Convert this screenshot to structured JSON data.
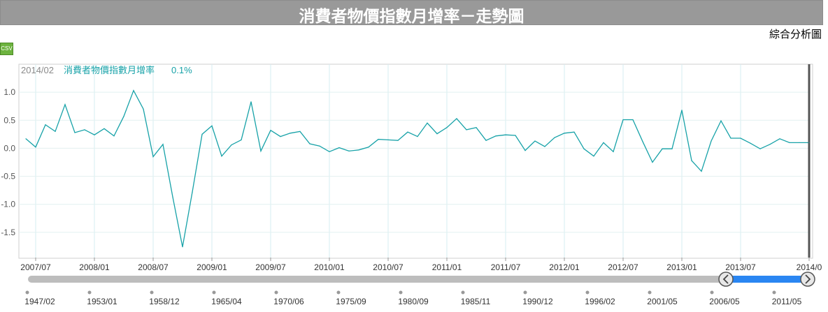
{
  "page": {
    "title": "消費者物價指數月增率－走勢圖",
    "composite_link": "綜合分析圖",
    "csv_button": "CSV"
  },
  "colors": {
    "line": "#17a2a8",
    "title_bar": "#999999",
    "navigator_handle_fill": "#2a86f2",
    "navigator_track": "#bdbdbd"
  },
  "tooltip": {
    "date": "2014/02",
    "series": "消費者物價指數月增率",
    "value": "0.1%"
  },
  "chart_data": {
    "type": "line",
    "title": "",
    "xlabel": "",
    "ylabel": "",
    "ylim": [
      -1.95,
      1.5
    ],
    "xlim": [
      "2007/06",
      "2014/02"
    ],
    "y_ticks": [
      "1.0",
      "0.5",
      "0.0",
      "-0.5",
      "-1.0",
      "-1.5"
    ],
    "x_ticks": [
      "2007/07",
      "2008/01",
      "2008/07",
      "2009/01",
      "2009/07",
      "2010/01",
      "2010/07",
      "2011/01",
      "2011/07",
      "2012/01",
      "2012/07",
      "2013/01",
      "2013/07",
      "2014/0"
    ],
    "series": [
      {
        "name": "消費者物價指數月增率",
        "x": [
          "2007/06",
          "2007/07",
          "2007/08",
          "2007/09",
          "2007/10",
          "2007/11",
          "2007/12",
          "2008/01",
          "2008/02",
          "2008/03",
          "2008/04",
          "2008/05",
          "2008/06",
          "2008/07",
          "2008/08",
          "2008/09",
          "2008/10",
          "2008/11",
          "2008/12",
          "2009/01",
          "2009/02",
          "2009/03",
          "2009/04",
          "2009/05",
          "2009/06",
          "2009/07",
          "2009/08",
          "2009/09",
          "2009/10",
          "2009/11",
          "2009/12",
          "2010/01",
          "2010/02",
          "2010/03",
          "2010/04",
          "2010/05",
          "2010/06",
          "2010/07",
          "2010/08",
          "2010/09",
          "2010/10",
          "2010/11",
          "2010/12",
          "2011/01",
          "2011/02",
          "2011/03",
          "2011/04",
          "2011/05",
          "2011/06",
          "2011/07",
          "2011/08",
          "2011/09",
          "2011/10",
          "2011/11",
          "2011/12",
          "2012/01",
          "2012/02",
          "2012/03",
          "2012/04",
          "2012/05",
          "2012/06",
          "2012/07",
          "2012/08",
          "2012/09",
          "2012/10",
          "2012/11",
          "2012/12",
          "2013/01",
          "2013/02",
          "2013/03",
          "2013/04",
          "2013/05",
          "2013/06",
          "2013/07",
          "2013/08",
          "2013/09",
          "2013/10",
          "2013/11",
          "2013/12",
          "2014/01",
          "2014/02"
        ],
        "y": [
          0.17,
          0.02,
          0.42,
          0.3,
          0.78,
          0.28,
          0.33,
          0.24,
          0.35,
          0.22,
          0.57,
          1.03,
          0.7,
          -0.15,
          0.07,
          -0.87,
          -1.76,
          -0.78,
          0.25,
          0.4,
          -0.14,
          0.06,
          0.15,
          0.83,
          -0.05,
          0.32,
          0.21,
          0.27,
          0.3,
          0.08,
          0.04,
          -0.06,
          0.01,
          -0.05,
          -0.03,
          0.02,
          0.16,
          0.15,
          0.14,
          0.29,
          0.21,
          0.45,
          0.26,
          0.37,
          0.53,
          0.33,
          0.37,
          0.14,
          0.22,
          0.24,
          0.23,
          -0.04,
          0.13,
          0.03,
          0.19,
          0.27,
          0.29,
          -0.01,
          -0.14,
          0.1,
          -0.06,
          0.51,
          0.51,
          0.12,
          -0.25,
          -0.01,
          -0.01,
          0.68,
          -0.22,
          -0.41,
          0.13,
          0.49,
          0.18,
          0.18,
          0.09,
          -0.01,
          0.07,
          0.17,
          0.1,
          0.1,
          0.1
        ]
      }
    ],
    "navigator": {
      "labels": [
        "1947/02",
        "1953/01",
        "1958/12",
        "1965/04",
        "1970/06",
        "1975/09",
        "1980/09",
        "1985/11",
        "1990/12",
        "1996/02",
        "2001/05",
        "2006/05",
        "2011/05"
      ]
    }
  }
}
